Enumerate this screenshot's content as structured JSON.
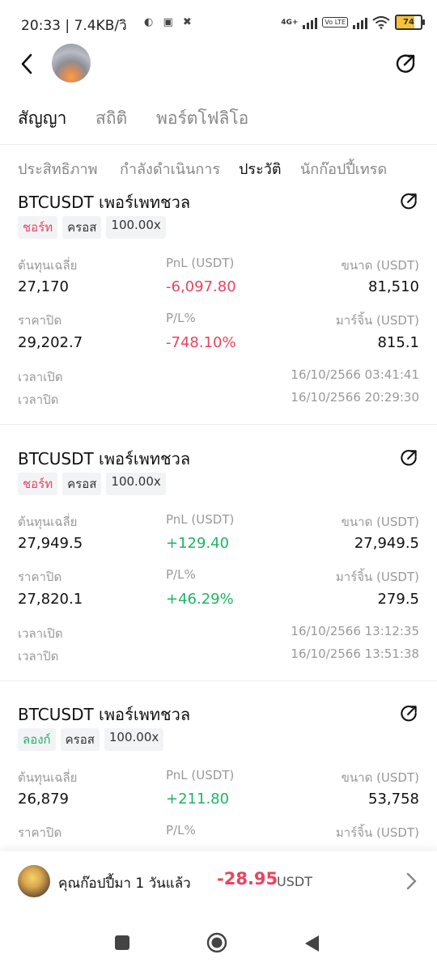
{
  "status_bar": {
    "time": "20:33 | 7.4KB/วิ",
    "net_label": "4G+",
    "volte": "Vo LTE",
    "battery": "74"
  },
  "header": {
    "tabs": [
      "สัญญา",
      "สถิติ",
      "พอร์ตโฟลิโอ"
    ],
    "active_tab": "สัญญา"
  },
  "subtabs": {
    "items": [
      "ประสิทธิภาพ",
      "กำลังดำเนินการ",
      "ประวัติ",
      "นักก๊อปปี้เทรด"
    ],
    "active": "ประวัติ"
  },
  "labels": {
    "avg_cost": "ต้นทุนเฉลี่ย",
    "pnl": "PnL (USDT)",
    "size": "ขนาด (USDT)",
    "close_price": "ราคาปิด",
    "pl_pct": "P/L%",
    "margin": "มาร์จิ้น (USDT)",
    "open_time": "เวลาเปิด",
    "close_time": "เวลาปิด"
  },
  "trades": [
    {
      "title": "BTCUSDT เพอร์เพทชวล",
      "side": "ชอร์ท",
      "side_type": "short",
      "mode": "ครอส",
      "leverage": "100.00x",
      "avg_cost": "27,170",
      "pnl": "-6,097.80",
      "pnl_sign": "neg",
      "size": "81,510",
      "close_price": "29,202.7",
      "pl_pct": "-748.10%",
      "margin": "815.1",
      "open_time": "16/10/2566 03:41:41",
      "close_time": "16/10/2566 20:29:30"
    },
    {
      "title": "BTCUSDT เพอร์เพทชวล",
      "side": "ชอร์ท",
      "side_type": "short",
      "mode": "ครอส",
      "leverage": "100.00x",
      "avg_cost": "27,949.5",
      "pnl": "+129.40",
      "pnl_sign": "pos",
      "size": "27,949.5",
      "close_price": "27,820.1",
      "pl_pct": "+46.29%",
      "margin": "279.5",
      "open_time": "16/10/2566 13:12:35",
      "close_time": "16/10/2566 13:51:38"
    },
    {
      "title": "BTCUSDT เพอร์เพทชวล",
      "side": "ลองก์",
      "side_type": "long",
      "mode": "ครอส",
      "leverage": "100.00x",
      "avg_cost": "26,879",
      "pnl": "+211.80",
      "pnl_sign": "pos",
      "size": "53,758"
    }
  ],
  "bottom_bar": {
    "text": "คุณก๊อปปี้มา 1 วันแล้ว",
    "amount": "-28.95",
    "unit": "USDT"
  },
  "colors": {
    "negative": "#e8445f",
    "positive": "#1fb464",
    "muted": "#999999"
  },
  "icons": [
    "back-arrow-icon",
    "share-icon",
    "chevron-right-icon",
    "recent-apps-icon",
    "home-icon",
    "nav-back-icon"
  ]
}
